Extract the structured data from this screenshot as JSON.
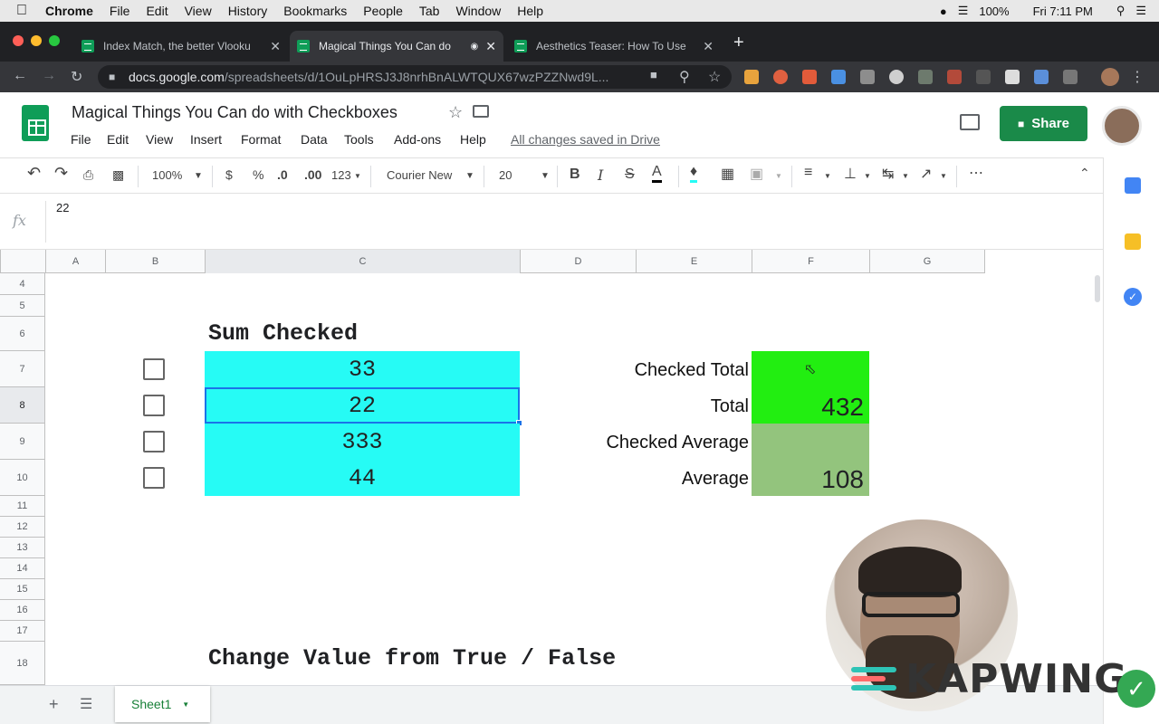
{
  "mac_menu": {
    "app": "Chrome",
    "items": [
      "File",
      "Edit",
      "View",
      "History",
      "Bookmarks",
      "People",
      "Tab",
      "Window",
      "Help"
    ],
    "battery": "100%",
    "clock": "Fri 7:11 PM"
  },
  "tabs": [
    {
      "title": "Index Match, the better Vlooku",
      "active": false
    },
    {
      "title": "Magical Things You Can do",
      "active": true
    },
    {
      "title": "Aesthetics Teaser: How To Use",
      "active": false
    }
  ],
  "url": {
    "host": "docs.google.com",
    "path": "/spreadsheets/d/1OuLpHRSJ3J8nrhBnALWTQUX67wzPZZNwd9L..."
  },
  "doc": {
    "title": "Magical Things You Can do with Checkboxes",
    "menus": [
      "File",
      "Edit",
      "View",
      "Insert",
      "Format",
      "Data",
      "Tools",
      "Add-ons",
      "Help"
    ],
    "saved": "All changes saved in Drive",
    "share": "Share"
  },
  "toolbar": {
    "zoom": "100%",
    "currency": "$",
    "percent": "%",
    "dec_less": ".0",
    "dec_more": ".00",
    "format": "123",
    "font": "Courier New",
    "size": "20"
  },
  "formula": {
    "fx": "fx",
    "value": "22"
  },
  "columns": [
    "A",
    "B",
    "C",
    "D",
    "E",
    "F",
    "G"
  ],
  "rows": [
    "4",
    "5",
    "6",
    "7",
    "8",
    "9",
    "10",
    "11",
    "12",
    "13",
    "14",
    "15",
    "16",
    "17",
    "18"
  ],
  "sheet": {
    "title1": "Sum Checked",
    "values": [
      "33",
      "22",
      "333",
      "44"
    ],
    "labels": [
      "Checked Total",
      "Total",
      "Checked Average",
      "Average"
    ],
    "results": [
      "",
      "432",
      "",
      "108"
    ],
    "title2": "Change Value from True / False"
  },
  "colors": {
    "cyan": "#26fbf5",
    "green": "#22ee11",
    "sage": "#93c47d",
    "share": "#1a8a49"
  },
  "bottom": {
    "sheet": "Sheet1"
  },
  "overlay": {
    "brand": "KAPWING"
  }
}
